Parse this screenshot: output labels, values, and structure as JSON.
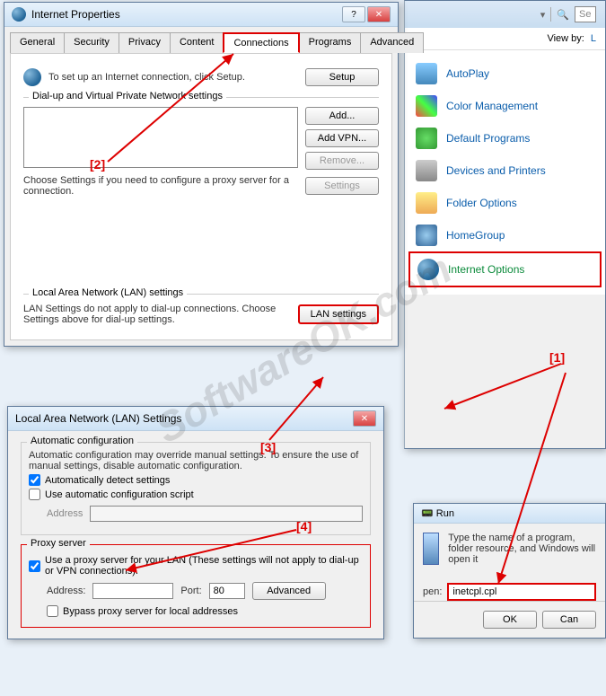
{
  "watermark": "SoftwareOK.com",
  "anno": {
    "a1": "[1]",
    "a2": "[2]",
    "a3": "[3]",
    "a4": "[4]"
  },
  "inet": {
    "title": "Internet Properties",
    "tabs": [
      "General",
      "Security",
      "Privacy",
      "Content",
      "Connections",
      "Programs",
      "Advanced"
    ],
    "setup_text": "To set up an Internet connection, click Setup.",
    "setup_btn": "Setup",
    "dialup_group": "Dial-up and Virtual Private Network settings",
    "add_btn": "Add...",
    "addvpn_btn": "Add VPN...",
    "remove_btn": "Remove...",
    "choose_text": "Choose Settings if you need to configure a proxy server for a connection.",
    "settings_btn": "Settings",
    "lan_group": "Local Area Network (LAN) settings",
    "lan_text": "LAN Settings do not apply to dial-up connections. Choose Settings above for dial-up settings.",
    "lan_btn": "LAN settings"
  },
  "lan": {
    "title": "Local Area Network (LAN) Settings",
    "auto_group": "Automatic configuration",
    "auto_text": "Automatic configuration may override manual settings.  To ensure the use of manual settings, disable automatic configuration.",
    "auto_detect": "Automatically detect settings",
    "auto_script": "Use automatic configuration script",
    "address_label": "Address",
    "proxy_group": "Proxy server",
    "proxy_use": "Use a proxy server for your LAN (These settings will not apply to dial-up or VPN connections).",
    "addr_label": "Address:",
    "port_label": "Port:",
    "port_value": "80",
    "advanced_btn": "Advanced",
    "bypass": "Bypass proxy server for local addresses"
  },
  "cp": {
    "viewby": "View by:",
    "items": [
      "AutoPlay",
      "Color Management",
      "Default Programs",
      "Devices and Printers",
      "Folder Options",
      "HomeGroup",
      "Internet Options"
    ],
    "search_placeholder": "Se"
  },
  "run": {
    "title": "Run",
    "text": "Type the name of a program, folder resource, and Windows will open it",
    "open_label": "pen:",
    "value": "inetcpl.cpl",
    "ok": "OK",
    "cancel": "Can"
  }
}
